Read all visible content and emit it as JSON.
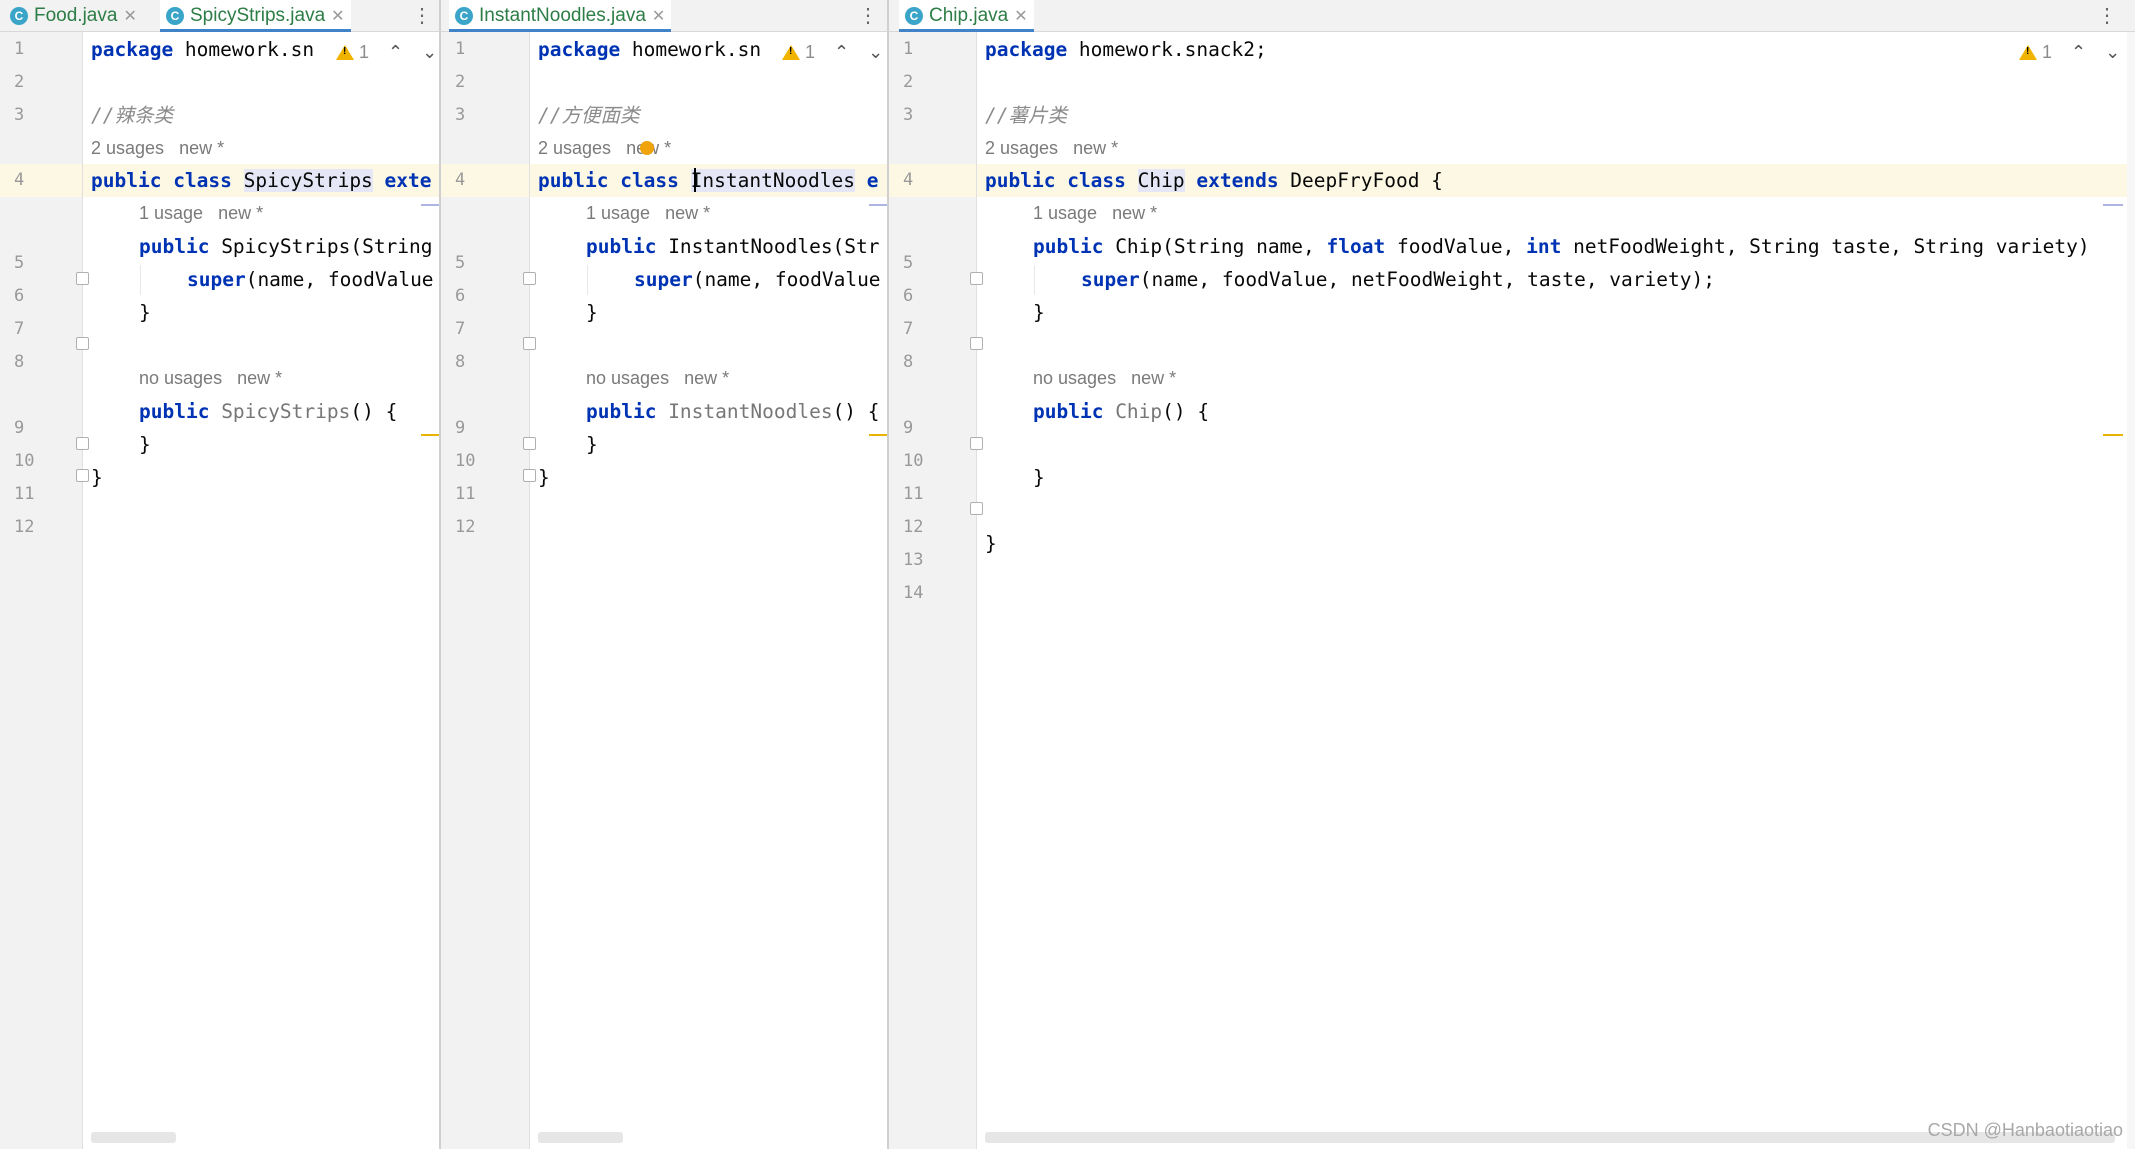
{
  "tabs_left": [
    {
      "label": "Food.java",
      "active": false
    },
    {
      "label": "SpicyStrips.java",
      "active": true
    }
  ],
  "tabs_middle": [
    {
      "label": "InstantNoodles.java",
      "active": true
    }
  ],
  "tabs_right": [
    {
      "label": "Chip.java",
      "active": true
    }
  ],
  "warning_count": "1",
  "line_numbers_12": [
    "1",
    "2",
    "3",
    "4",
    "5",
    "6",
    "7",
    "8",
    "9",
    "10",
    "11",
    "12"
  ],
  "line_numbers_14": [
    "1",
    "2",
    "3",
    "4",
    "5",
    "6",
    "7",
    "8",
    "9",
    "10",
    "11",
    "12",
    "13",
    "14"
  ],
  "hints": {
    "two_usages": "2 usages",
    "one_usage": "1 usage",
    "no_usages": "no usages",
    "new": "new *"
  },
  "code": {
    "kw_package": "package",
    "kw_public": "public",
    "kw_class": "class",
    "kw_extends": "extends",
    "kw_super": "super",
    "kw_float": "float",
    "kw_int": "int",
    "left": {
      "package_name": " homework.sn",
      "comment": "//辣条类",
      "class_name": "SpicyStrips",
      "extends_cut": "exte",
      "ctor_name": " SpicyStrips(String",
      "super_args": "(name, foodValue",
      "noarg_name": " SpicyStrips",
      "noarg_rest": "() {"
    },
    "middle": {
      "package_name": " homework.sn",
      "comment": "//方便面类",
      "class_name": "InstantNoodles",
      "extends_cut": "e",
      "ctor_name": " InstantNoodles(Str",
      "super_args": "(name, foodValue",
      "noarg_name": " InstantNoodles",
      "noarg_rest": "() {"
    },
    "right": {
      "package_name": " homework.snack2;",
      "comment": "//薯片类",
      "class_name": "Chip",
      "super_class": " DeepFryFood {",
      "ctor_part1": " Chip(String name, ",
      "ctor_part2": " foodValue, ",
      "ctor_part3": " netFoodWeight, String taste, String variety)",
      "super_args": "(name, foodValue, netFoodWeight, taste, variety);",
      "noarg_name": " Chip",
      "noarg_rest": "() {"
    },
    "close_brace": "}"
  },
  "watermark": "CSDN @Hanbaotiaotiao"
}
